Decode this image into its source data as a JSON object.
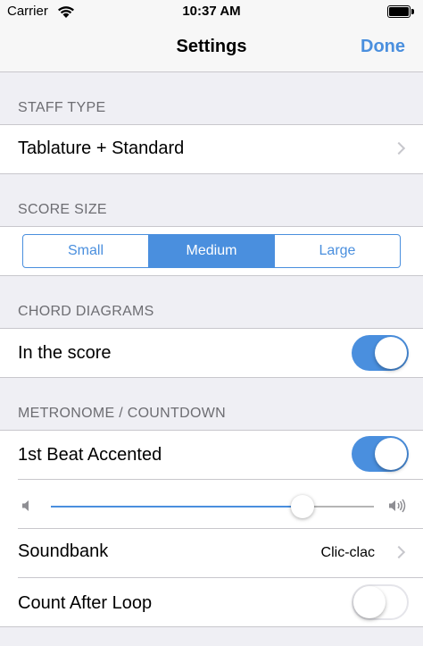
{
  "status_bar": {
    "carrier": "Carrier",
    "time": "10:37 AM",
    "icons": [
      "wifi-icon",
      "battery-icon"
    ]
  },
  "nav": {
    "title": "Settings",
    "done_label": "Done"
  },
  "sections": {
    "staff_type": {
      "header": "STAFF TYPE",
      "row_label": "Tablature + Standard"
    },
    "score_size": {
      "header": "SCORE SIZE",
      "segments": [
        "Small",
        "Medium",
        "Large"
      ],
      "selected": "Medium"
    },
    "chord_diagrams": {
      "header": "CHORD DIAGRAMS",
      "in_score_label": "In the score",
      "in_score_on": true
    },
    "metronome": {
      "header": "METRONOME / COUNTDOWN",
      "accent_label": "1st Beat Accented",
      "accent_on": true,
      "volume_fraction": 0.78,
      "soundbank_label": "Soundbank",
      "soundbank_value": "Clic-clac",
      "count_after_loop_label": "Count After Loop",
      "count_after_loop_on": false
    }
  },
  "colors": {
    "accent": "#4a8fde",
    "background": "#efeff4",
    "separator": "#c8c7cc",
    "header_text": "#6d6d72"
  }
}
